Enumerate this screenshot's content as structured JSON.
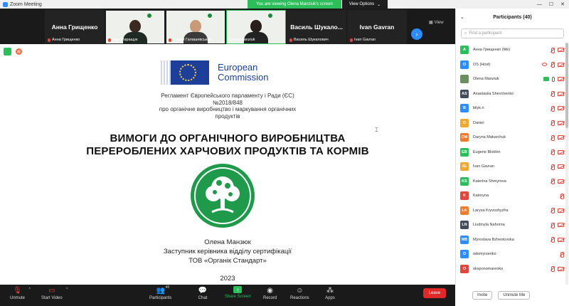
{
  "window": {
    "title": "Zoom Meeting",
    "minimize": "—",
    "maximize": "☐",
    "close": "✕"
  },
  "banner": {
    "viewing_text": "You are viewing Olena Manziuk's screen",
    "view_options": "View Options"
  },
  "video_strip": {
    "tiles": [
      {
        "big_name": "Анна Грищенко",
        "label": "Анна Грищенко",
        "type": "name"
      },
      {
        "big_name": "",
        "label": "Віра Паращук",
        "type": "video"
      },
      {
        "big_name": "",
        "label": "Сергій Галашевський",
        "type": "video"
      },
      {
        "big_name": "",
        "label": "Olena Manziuk",
        "type": "video"
      },
      {
        "big_name": "Василь Шукало...",
        "label": "Василь Шукалович",
        "type": "name"
      },
      {
        "big_name": "Ivan Gavran",
        "label": "Ivan Gavran",
        "type": "name"
      }
    ],
    "view_label": "View",
    "next_arrow": "›"
  },
  "slide": {
    "ec_line1": "European",
    "ec_line2": "Commission",
    "reg_line1": "Регламент Європейського парламенту і Ради (ЄС)",
    "reg_line2": "№2018/848",
    "reg_line3": "про органічне виробництво і маркування органічних",
    "reg_line4": "продуктів",
    "heading_line1": "ВИМОГИ ДО ОРГАНІЧНОГО ВИРОБНИЦТВА",
    "heading_line2": "ПЕРЕРОБЛЕНИХ ХАРЧОВИХ ПРОДУКТІВ ТА КОРМІВ",
    "author_name": "Олена Манзюк",
    "author_role": "Заступник керівника відділу сертифікації",
    "author_org": "ТОВ «Органік Стандарт»",
    "year": "2023"
  },
  "toolbar": {
    "unmute": "Unmute",
    "start_video": "Start Video",
    "participants": "Participants",
    "participants_count": "40",
    "chat": "Chat",
    "share_screen": "Share Screen",
    "record": "Record",
    "reactions": "Reactions",
    "apps": "Apps",
    "leave": "Leave"
  },
  "panel": {
    "title": "Participants (40)",
    "search_placeholder": "Find a participant",
    "collapse": "⌄",
    "invite": "Invite",
    "unmute_me": "Unmute Me",
    "participants": [
      {
        "initials": "А",
        "name": "Анна Грищенко (Me)",
        "color": "#2dbe5b",
        "status": "off"
      },
      {
        "initials": "O",
        "name": "OS (Host)",
        "color": "#2d8cff",
        "status": "host"
      },
      {
        "initials": "",
        "name": "Olena Manziuk",
        "color": "#6b8f5e",
        "status": "on"
      },
      {
        "initials": "AS",
        "name": "Anastasiia Shevchenko",
        "color": "#444c5c",
        "status": "off"
      },
      {
        "initials": "B",
        "name": "bilyk.ri",
        "color": "#2d8cff",
        "status": "off"
      },
      {
        "initials": "D",
        "name": "Daniel",
        "color": "#f0a830",
        "status": "off"
      },
      {
        "initials": "DM",
        "name": "Daryna Makarchuk",
        "color": "#f07a30",
        "status": "off"
      },
      {
        "initials": "EB",
        "name": "Eugene Blokhin",
        "color": "#2dbe5b",
        "status": "off"
      },
      {
        "initials": "IG",
        "name": "Ivan Gavran",
        "color": "#f0a830",
        "status": "off"
      },
      {
        "initials": "KS",
        "name": "Katerina Shmyrova",
        "color": "#2dbe5b",
        "status": "off"
      },
      {
        "initials": "K",
        "name": "Katoryna",
        "color": "#e0463c",
        "status": "mic"
      },
      {
        "initials": "LK",
        "name": "Larysa Kryvoshyzha",
        "color": "#f07a30",
        "status": "off"
      },
      {
        "initials": "LN",
        "name": "Liudmyla Nahorna",
        "color": "#444c5c",
        "status": "off"
      },
      {
        "initials": "MB",
        "name": "Myroslava Bzhestovska",
        "color": "#2d8cff",
        "status": "off"
      },
      {
        "initials": "O",
        "name": "odsmyrzenko",
        "color": "#2d8cff",
        "status": "mic"
      },
      {
        "initials": "O",
        "name": "oksponomarenko",
        "color": "#e0463c",
        "status": "off"
      }
    ]
  }
}
